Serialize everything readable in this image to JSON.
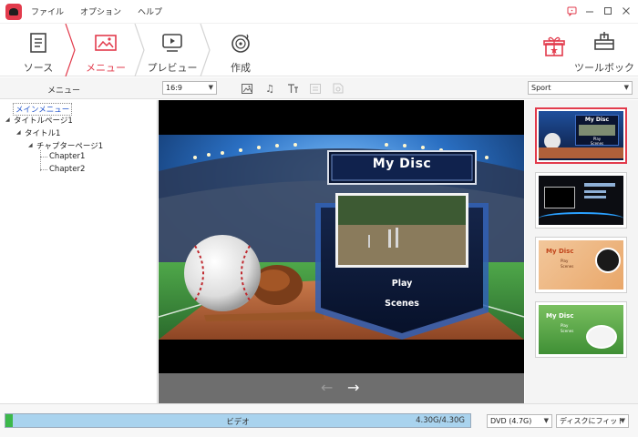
{
  "menubar": {
    "items": [
      "ファイル",
      "オプション",
      "ヘルプ"
    ]
  },
  "window_controls": [
    "comment-icon",
    "minimize-icon",
    "maximize-icon",
    "close-icon"
  ],
  "steps": [
    {
      "label": "ソース",
      "icon": "source-doc-icon",
      "active": false
    },
    {
      "label": "メニュー",
      "icon": "menu-image-icon",
      "active": true
    },
    {
      "label": "プレビュー",
      "icon": "preview-play-icon",
      "active": false
    },
    {
      "label": "作成",
      "icon": "burn-disc-icon",
      "active": false
    }
  ],
  "toolbox": {
    "label": "ツールボックス",
    "icon": "toolbox-icon"
  },
  "gift": {
    "icon": "gift-icon"
  },
  "subbar": {
    "menu_label": "メニュー",
    "aspect_select": "16:9",
    "tool_icons": [
      "background-image-icon",
      "music-note-icon",
      "text-icon",
      "chapter-icon",
      "layout-icon"
    ],
    "template_select": "Sport"
  },
  "tree": {
    "items": [
      {
        "label": "メインメニュー",
        "selected": true
      },
      {
        "label": "タイトルページ1"
      },
      {
        "label": "タイトル1"
      },
      {
        "label": "チャプターページ1"
      },
      {
        "label": "Chapter1"
      },
      {
        "label": "Chapter2"
      }
    ]
  },
  "disc_menu": {
    "title": "My Disc",
    "buttons": [
      "Play",
      "Scenes"
    ]
  },
  "preview_nav": {
    "prev": "←",
    "next": "→"
  },
  "templates": {
    "thumbs": [
      {
        "title": "My Disc",
        "lines": [
          "Play",
          "Scenes"
        ],
        "selected": true
      },
      {
        "title": "",
        "lines": [],
        "selected": false
      },
      {
        "title": "My Disc",
        "lines": [
          "Play",
          "Scenes"
        ],
        "selected": false
      },
      {
        "title": "My Disc",
        "lines": [
          "Play",
          "Scenes"
        ],
        "selected": false
      }
    ]
  },
  "bottom": {
    "capacity_label": "ビデオ",
    "capacity_used": "4.30G/4.30G",
    "disc_type": "DVD (4.7G)",
    "fit_option": "ディスクにフィット"
  },
  "colors": {
    "accent": "#e23b4c",
    "capacity_fill": "#a9d3ee",
    "capacity_green": "#3cb84a"
  }
}
